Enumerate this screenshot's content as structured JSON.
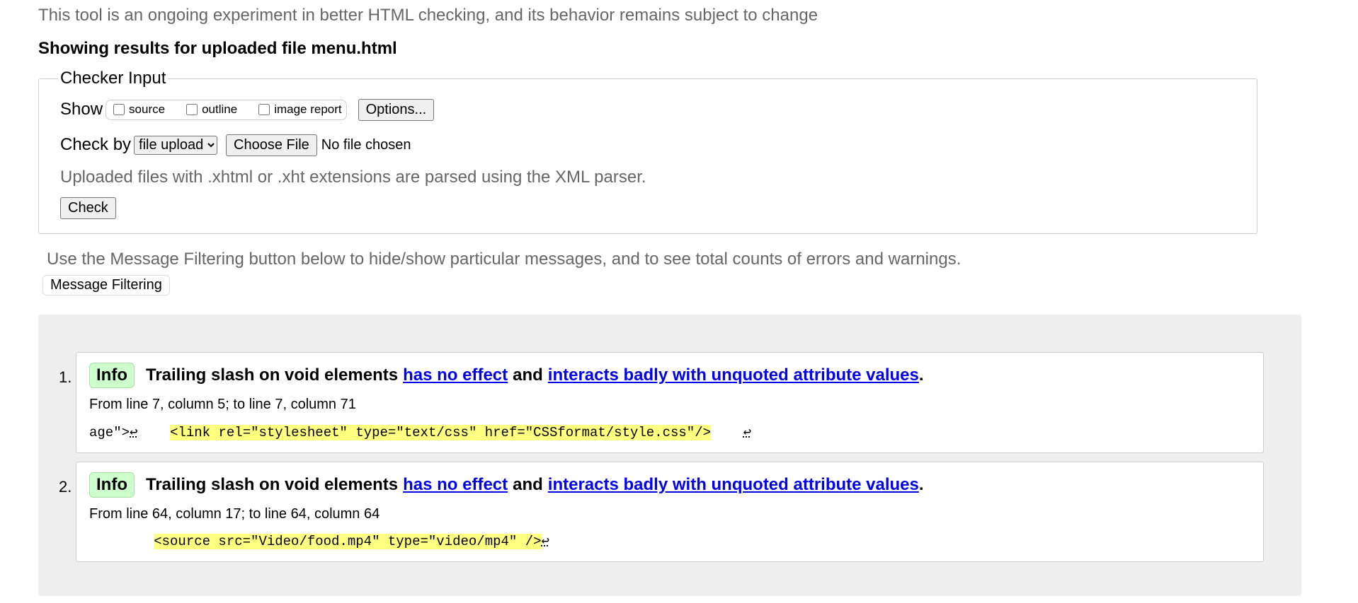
{
  "intro": "This tool is an ongoing experiment in better HTML checking, and its behavior remains subject to change",
  "results_title": "Showing results for uploaded file menu.html",
  "checker": {
    "legend": "Checker Input",
    "show_label": "Show",
    "show_options": [
      "source",
      "outline",
      "image report"
    ],
    "options_button": "Options...",
    "checkby_label": "Check by",
    "method_selected": "file upload",
    "choose_file_button": "Choose File",
    "file_status": "No file chosen",
    "note": "Uploaded files with .xhtml or .xht extensions are parsed using the XML parser.",
    "check_button": "Check"
  },
  "filter_hint": "Use the Message Filtering button below to hide/show particular messages, and to see total counts of errors and warnings.",
  "filter_button": "Message Filtering",
  "messages": [
    {
      "num": "1.",
      "type": "Info",
      "text_before": "Trailing slash on void elements",
      "link1": "has no effect",
      "text_mid": "and",
      "link2": "interacts badly with unquoted attribute values",
      "text_end": ".",
      "location": "From line 7, column 5; to line 7, column 71",
      "extract_pre": "age\">",
      "lf_pre": "↩",
      "extract_gap": "    ",
      "extract_hl": "<link rel=\"stylesheet\" type=\"text/css\" href=\"CSSformat/style.css\"/>",
      "extract_post": "    ",
      "lf_post": "↩"
    },
    {
      "num": "2.",
      "type": "Info",
      "text_before": "Trailing slash on void elements",
      "link1": "has no effect",
      "text_mid": "and",
      "link2": "interacts badly with unquoted attribute values",
      "text_end": ".",
      "location": "From line 64, column 17; to line 64, column 64",
      "extract_pre": "        ",
      "extract_hl": "<source src=\"Video/food.mp4\" type=\"video/mp4\" />",
      "lf_post": "↩"
    }
  ],
  "colors": {
    "info_badge": "#ccffcc",
    "highlight": "#ffff80",
    "link": "#0000ee"
  }
}
